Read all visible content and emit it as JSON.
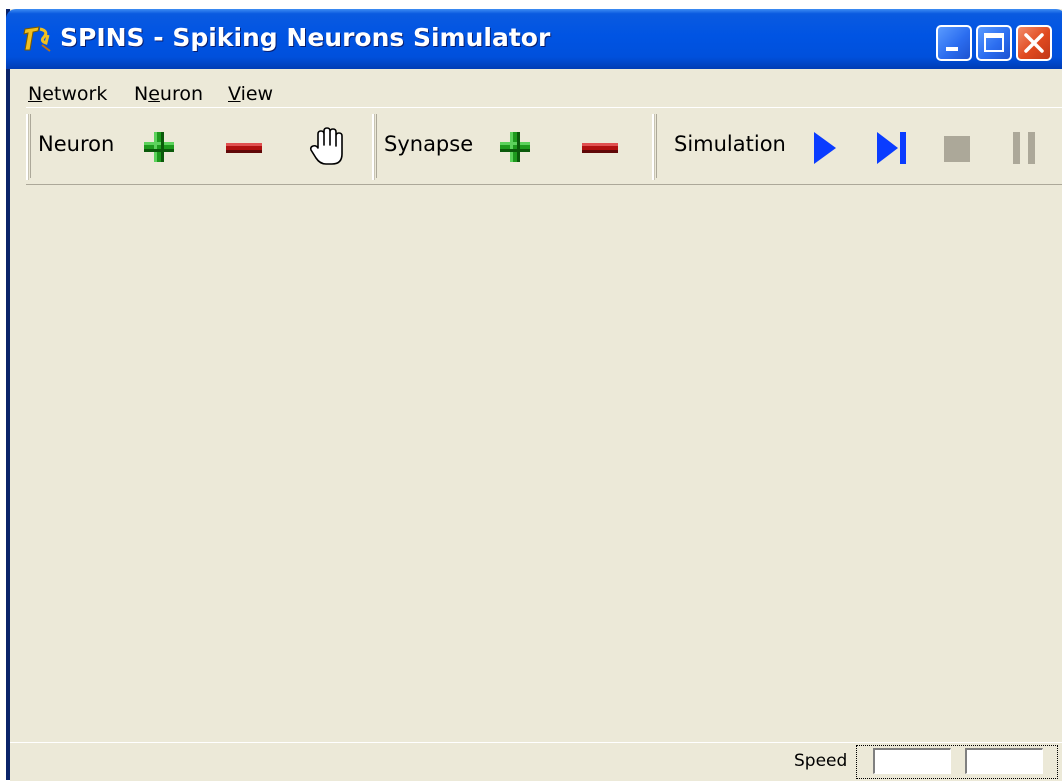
{
  "window": {
    "title": "SPINS - Spiking Neurons Simulator",
    "controls": [
      "minimize",
      "maximize",
      "close"
    ]
  },
  "menu": {
    "items": [
      {
        "label": "Network",
        "mnemonic": "N"
      },
      {
        "label": "Neuron",
        "mnemonic": "e"
      },
      {
        "label": "View",
        "mnemonic": "V"
      }
    ]
  },
  "toolbar": {
    "neuron": {
      "label": "Neuron",
      "icons": [
        "add-icon",
        "remove-icon",
        "hand-pan-icon"
      ]
    },
    "synapse": {
      "label": "Synapse",
      "icons": [
        "add-icon",
        "remove-icon"
      ]
    },
    "simulation": {
      "label": "Simulation",
      "icons": [
        "play-icon",
        "step-icon",
        "stop-icon",
        "pause-icon"
      ]
    }
  },
  "statusbar": {
    "speed_label": "Speed",
    "speed_fields": [
      "",
      ""
    ]
  },
  "colors": {
    "add": "#1E9A1E",
    "remove": "#B01010",
    "play": "#0A3CFF",
    "disabled": "#ACA899",
    "titlebar": "#0054E3",
    "face": "#ECE9D8"
  }
}
